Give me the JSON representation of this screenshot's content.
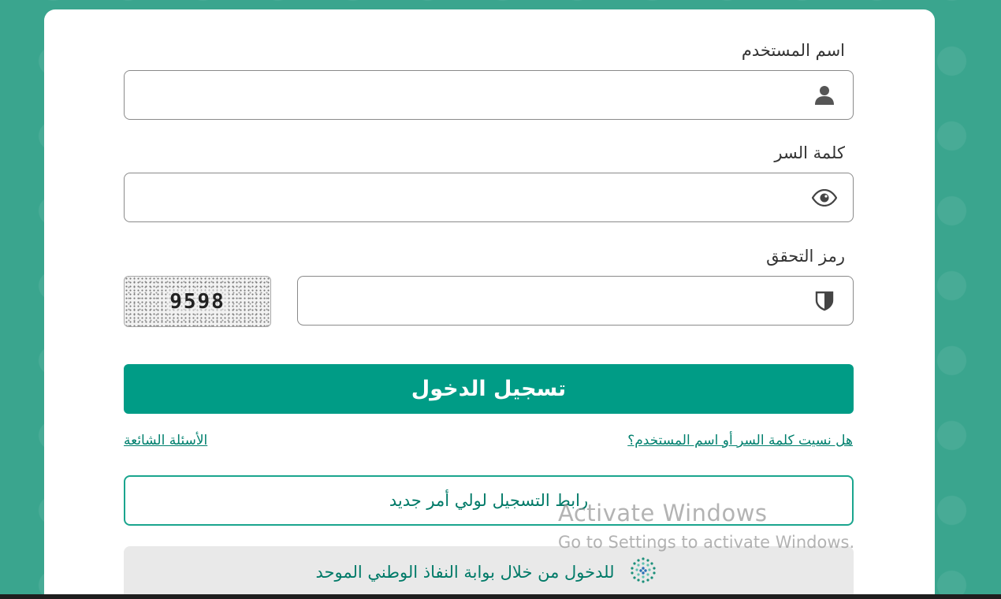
{
  "form": {
    "username_label": "اسم المستخدم",
    "username_value": "",
    "password_label": "كلمة السر",
    "password_value": "",
    "captcha_label": "رمز التحقق",
    "captcha_value": "",
    "captcha_code": "9598"
  },
  "buttons": {
    "login": "تسجيل الدخول",
    "register_guardian": "رابط التسجيل لولي أمر جديد",
    "nafath_login": "للدخول من خلال بوابة النفاذ الوطني الموحد"
  },
  "links": {
    "forgot": "هل نسيت كلمة السر أو اسم المستخدم؟",
    "faq": "الأسئلة الشائعة"
  },
  "watermark": {
    "line1": "Activate Windows",
    "line2": "Go to Settings to activate Windows."
  },
  "icons": {
    "username": "user-icon",
    "password": "eye-icon",
    "captcha": "shield-icon",
    "nafath": "nafath-logo-icon"
  },
  "colors": {
    "background": "#3aa58e",
    "primary": "#009c86",
    "link": "#00806e"
  }
}
